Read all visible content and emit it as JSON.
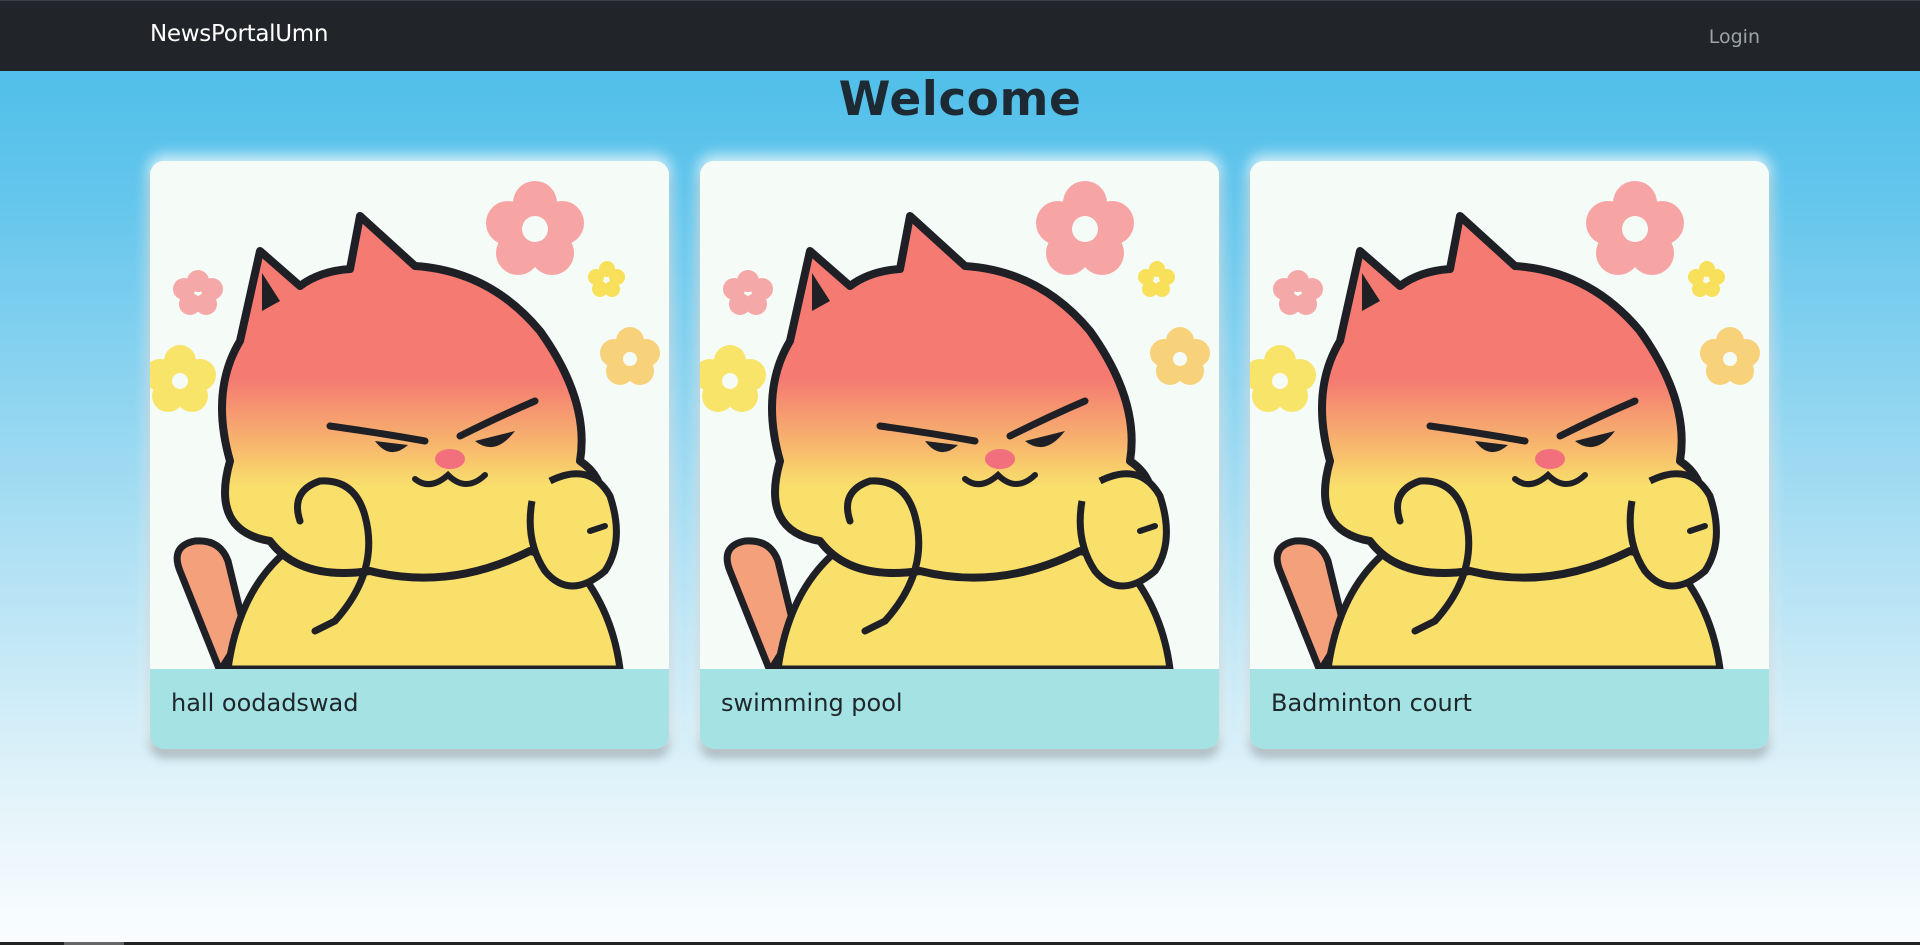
{
  "nav": {
    "brand": "NewsPortalUmn",
    "login": "Login"
  },
  "page": {
    "heading": "Welcome"
  },
  "cards": [
    {
      "title": "hall oodadswad",
      "image": "cartoon-cat-image"
    },
    {
      "title": "swimming pool",
      "image": "cartoon-cat-image"
    },
    {
      "title": "Badminton court",
      "image": "cartoon-cat-image"
    }
  ],
  "colors": {
    "navbar": "#212529",
    "card_footer": "#a4e2e4",
    "background_top": "#46bce8",
    "background_bottom": "#fbfdfe"
  }
}
